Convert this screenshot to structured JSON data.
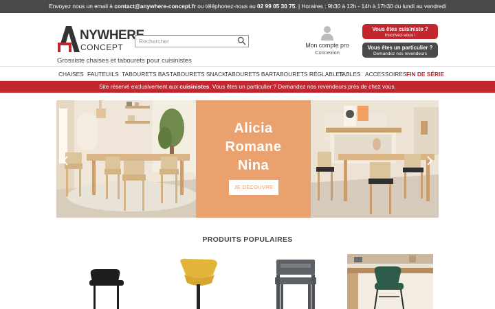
{
  "topbar": {
    "prefix": "Envoyez nous un email à ",
    "email": "contact@anywhere-concept.fr",
    "phone_prefix": " ou téléphonez-nous au ",
    "phone": "02 99 05 30 75.",
    "hours": " | Horaires : 9h30 à 12h - 14h à 17h30 du lundi au vendredi"
  },
  "logo": {
    "line1": "NYWHERE",
    "line2": "CONCEPT"
  },
  "tagline": "Grossiste chaises et tabourets pour cuisinistes",
  "search": {
    "placeholder": "Rechercher"
  },
  "account": {
    "title": "Mon compte pro",
    "subtitle": "Connexion"
  },
  "cta_pro": {
    "line1": "Vous êtes cuisiniste ?",
    "line2": "Inscrivez-vous !"
  },
  "cta_particulier": {
    "line1": "Vous êtes un particulier ?",
    "line2": "Demandez nos revendeurs"
  },
  "nav": [
    "CHAISES",
    "FAUTEUILS",
    "TABOURETS BAS",
    "TABOURETS SNACK",
    "TABOURETS BAR",
    "TABOURETS RÉGLABLES",
    "TABLES",
    "ACCESSOIRES",
    "FIN DE SÉRIE"
  ],
  "banner": {
    "prefix": "Site réservé exclusivement aux ",
    "bold": "cuisinistes",
    "suffix": ". Vous êtes un particulier ? Demandez nos revendeurs près de chez vous."
  },
  "hero": {
    "names": [
      "Alicia",
      "Romane",
      "Nina"
    ],
    "button": "JE DÉCOUVRE"
  },
  "popular": {
    "title": "PRODUITS POPULAIRES"
  },
  "colors": {
    "brand_red": "#c2262e",
    "dark_grey": "#4a4a4a",
    "hero_orange": "#eba16e"
  }
}
